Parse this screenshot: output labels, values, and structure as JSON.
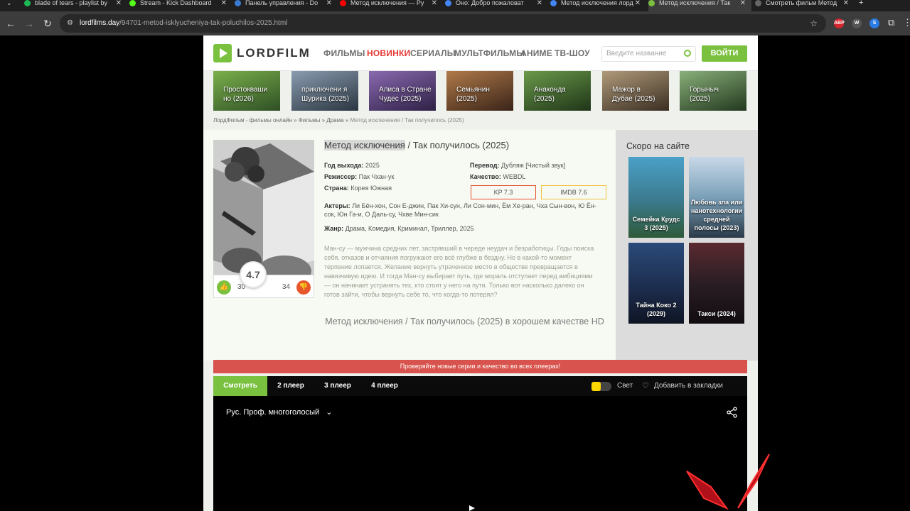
{
  "browser": {
    "tabs": [
      {
        "title": "blade of tears - playlist by",
        "color": "#1db954"
      },
      {
        "title": "Stream - Kick Dashboard",
        "color": "#53fc18"
      },
      {
        "title": "Панель управления - Do",
        "color": "#3a7bd5"
      },
      {
        "title": "Метод исключения — Pу",
        "color": "#ff0000"
      },
      {
        "title": "Оно: Добро пожаловат",
        "color": "#4285f4"
      },
      {
        "title": "Метод исключения лорд",
        "color": "#4285f4"
      },
      {
        "title": "Метод исключения / Так",
        "color": "#7bc140"
      },
      {
        "title": "Смотреть фильм Метод",
        "color": "#666666"
      }
    ],
    "url_domain": "lordfilms.day",
    "url_path": "/94701-metod-isklyucheniya-tak-poluchilos-2025.html",
    "extensions": [
      "ABP",
      "W",
      "S"
    ]
  },
  "site": {
    "logo": "LORDFILM",
    "menu": [
      "ФИЛЬМЫ",
      "НОВИНКИ",
      "СЕРИАЛЫ",
      "МУЛЬТФИЛЬМЫ",
      "АНИМЕ",
      "ТВ-ШОУ"
    ],
    "search_placeholder": "Введите название",
    "login": "ВОЙТИ",
    "accent": "#7bc140"
  },
  "carousel": [
    {
      "title": "Простокваши но (2026)",
      "bg": "#3f6b2e"
    },
    {
      "title": "приключени я Шурика (2025)",
      "bg": "#4a5a6b"
    },
    {
      "title": "Алиса в Стране Чудес (2025)",
      "bg": "#5e4a7a"
    },
    {
      "title": "Семьянин (2025)",
      "bg": "#6b4a36"
    },
    {
      "title": "Анаконда (2025)",
      "bg": "#3e5e35"
    },
    {
      "title": "Мажор в Дубае (2025)",
      "bg": "#6b5a4a"
    },
    {
      "title": "Горыныч (2025)",
      "bg": "#4a6b4a"
    }
  ],
  "breadcrumb": {
    "path": "ЛордФильм - фильмы онлайн » Фильмы » Драма » ",
    "current": "Метод исключения / Так получилось (2025)"
  },
  "movie": {
    "title_hl": "Метод исключения",
    "title_rest": " / Так получилось (2025)",
    "year_label": "Год выхода:",
    "year": "2025",
    "director_label": "Режиссер:",
    "director": "Пак Чхан-ук",
    "country_label": "Страна:",
    "country": "Корея Южная",
    "translation_label": "Перевод:",
    "translation": "Дубляж [Чистый звук]",
    "quality_label": "Качество:",
    "quality": "WEBDL",
    "kp": "KP 7.3",
    "imdb": "IMDB 7.6",
    "actors_label": "Актеры:",
    "actors": "Ли Бён-хон, Сон Е-джин, Пак Хи-сун, Ли Сон-мин, Ём Хе-ран, Чха Сын-вон, Ю Ён-сок, Юн Га-и, О Даль-су, Чхве Мин-сик",
    "genre_label": "Жанр:",
    "genre": "Драма, Комедия, Криминал, Триллер, 2025",
    "description": "Ман-су — мужчина средних лет, застрявший в череде неудач и безработицы. Годы поиска себя, отказов и отчаяния погружают его всё глубже в бездну. Но в какой-то момент терпение лопается. Желание вернуть утраченное место в обществе превращается в навязчивую идею. И тогда Ман-су выбирает путь, где мораль отступает перед амбициями — он начинает устранять тех, кто стоит у него на пути. Только вот насколько далеко он готов зайти, чтобы вернуть себе то, что когда-то потерял?",
    "hd_title": "Метод исключения / Так получилось (2025) в хорошем качестве HD",
    "score": "4.7",
    "likes": "30",
    "dislikes": "34"
  },
  "sidebar": {
    "title": "Скоро на сайте",
    "items": [
      {
        "title": "Семейка Крудс 3 (2025)",
        "bg": "#3b7a8c"
      },
      {
        "title": "Любовь зла или нанотехнологии средней полосы (2023)",
        "bg": "#7aa0b8"
      },
      {
        "title": "Тайна Коко 2 (2029)",
        "bg": "#1c2b4a"
      },
      {
        "title": "Такси (2024)",
        "bg": "#2a1e24"
      }
    ]
  },
  "notice": "Проверяйте новые серии и качество во всех плеерах!",
  "player": {
    "tabs": [
      "Смотреть",
      "2 плеер",
      "3 плеер",
      "4 плеер"
    ],
    "light": "Свет",
    "bookmark": "Добавить в закладки",
    "audio": "Рус. Проф. многоголосый"
  }
}
